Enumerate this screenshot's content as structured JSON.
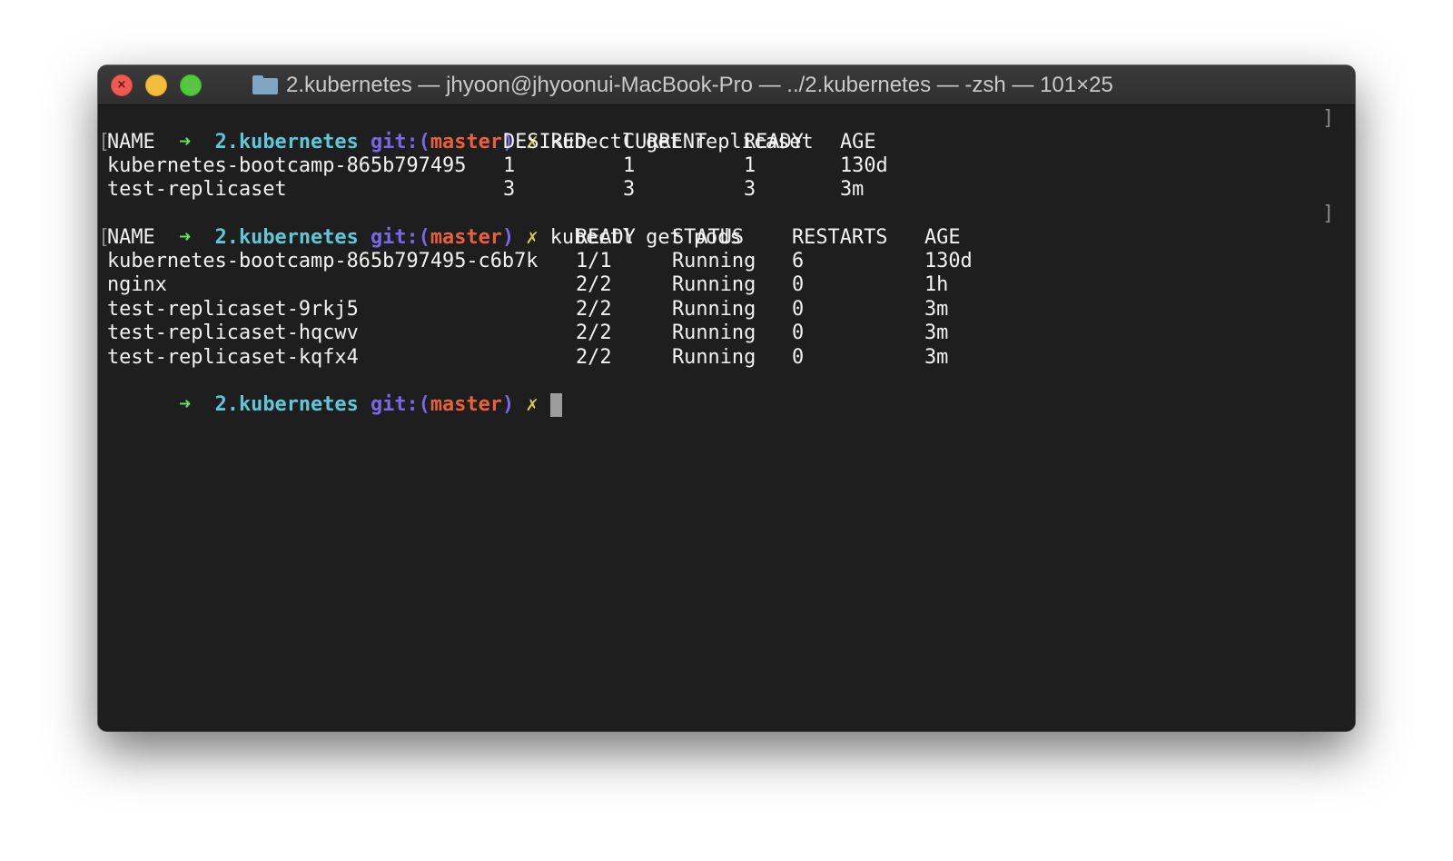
{
  "window": {
    "title": "2.kubernetes — jhyoon@jhyoonui-MacBook-Pro — ../2.kubernetes — -zsh — 101×25",
    "folder_icon": "folder-icon",
    "buttons": [
      "close",
      "minimize",
      "zoom"
    ]
  },
  "prompt": {
    "arrow": "➜",
    "dir": "2.kubernetes",
    "git_label": "git:(",
    "branch": "master",
    "git_close": ")",
    "dirty_mark": "✗"
  },
  "commands": [
    {
      "text": "kubectl get replicaset",
      "headers": [
        "NAME",
        "DESIRED",
        "CURRENT",
        "READY",
        "AGE"
      ],
      "rows": [
        [
          "kubernetes-bootcamp-865b797495",
          "1",
          "1",
          "1",
          "130d"
        ],
        [
          "test-replicaset",
          "3",
          "3",
          "3",
          "3m"
        ]
      ]
    },
    {
      "text": "kubectl get pods",
      "headers": [
        "NAME",
        "READY",
        "STATUS",
        "RESTARTS",
        "AGE"
      ],
      "rows": [
        [
          "kubernetes-bootcamp-865b797495-c6b7k",
          "1/1",
          "Running",
          "6",
          "130d"
        ],
        [
          "nginx",
          "2/2",
          "Running",
          "0",
          "1h"
        ],
        [
          "test-replicaset-9rkj5",
          "2/2",
          "Running",
          "0",
          "3m"
        ],
        [
          "test-replicaset-hqcwv",
          "2/2",
          "Running",
          "0",
          "3m"
        ],
        [
          "test-replicaset-kqfx4",
          "2/2",
          "Running",
          "0",
          "3m"
        ]
      ]
    }
  ],
  "colors": {
    "background": "#1e1e1e",
    "arrow": "#60e05b",
    "dir": "#5ec7d8",
    "git": "#7a67e8",
    "branch": "#e8613b",
    "dirty": "#d4cc55"
  }
}
